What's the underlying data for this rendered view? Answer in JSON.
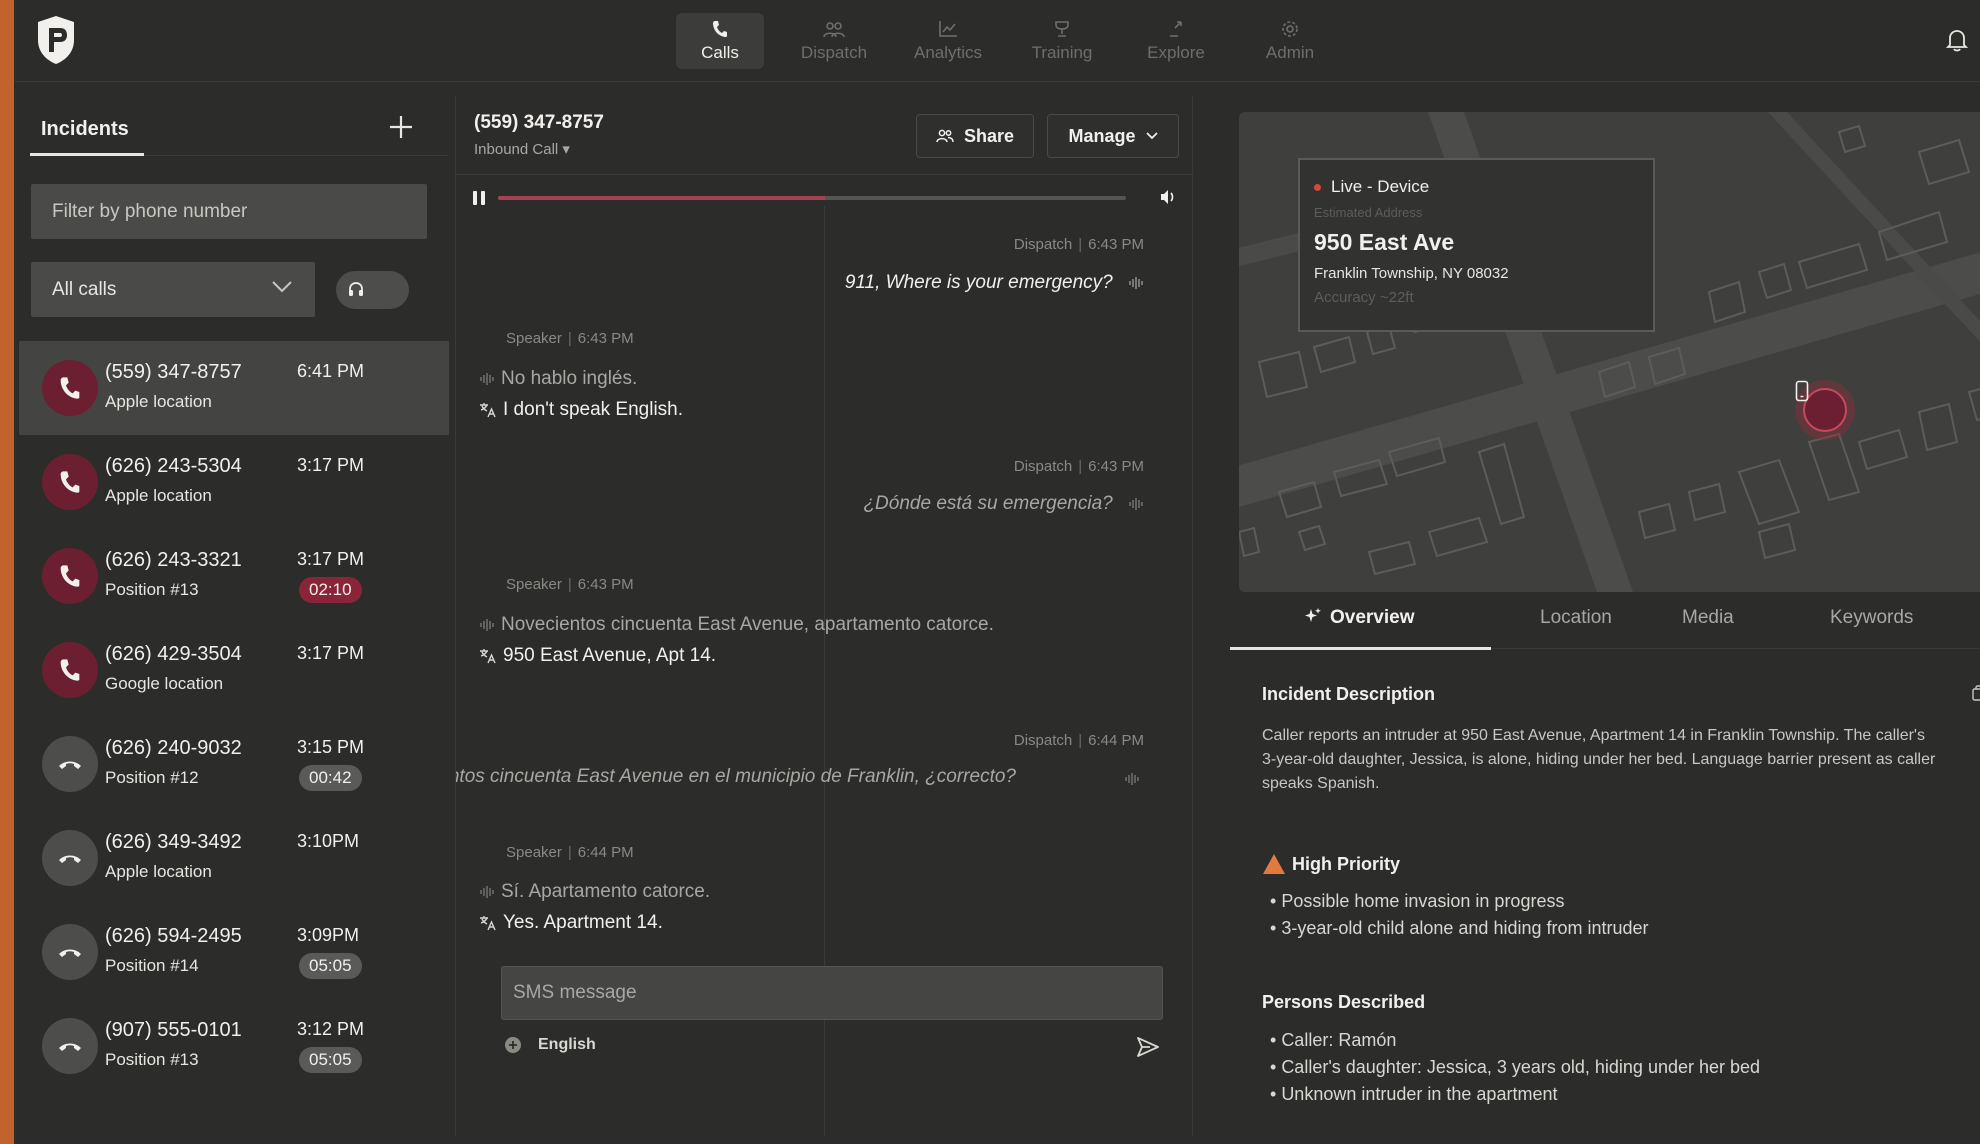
{
  "nav": {
    "items": [
      {
        "label": "Calls",
        "icon": "phone-icon",
        "active": true
      },
      {
        "label": "Dispatch",
        "icon": "dispatch-icon",
        "active": false
      },
      {
        "label": "Analytics",
        "icon": "analytics-icon",
        "active": false
      },
      {
        "label": "Training",
        "icon": "training-icon",
        "active": false
      },
      {
        "label": "Explore",
        "icon": "explore-icon",
        "active": false
      },
      {
        "label": "Admin",
        "icon": "gear-icon",
        "active": false
      }
    ]
  },
  "incidents": {
    "tab_label": "Incidents",
    "filter_placeholder": "Filter by phone number",
    "select_value": "All calls",
    "calls": [
      {
        "number": "(559) 347-8757",
        "sub": "Apple location",
        "time": "6:41 PM",
        "badge": "",
        "status": "active"
      },
      {
        "number": "(626) 243-5304",
        "sub": "Apple location",
        "time": "3:17 PM",
        "badge": "",
        "status": "active"
      },
      {
        "number": "(626) 243-3321",
        "sub": "Position #13",
        "time": "3:17 PM",
        "badge": "02:10",
        "status": "active"
      },
      {
        "number": "(626) 429-3504",
        "sub": "Google location",
        "time": "3:17 PM",
        "badge": "",
        "status": "active"
      },
      {
        "number": "(626) 240-9032",
        "sub": "Position #12",
        "time": "3:15 PM",
        "badge": "00:42",
        "status": "ended"
      },
      {
        "number": "(626) 349-3492",
        "sub": "Apple location",
        "time": "3:10PM",
        "badge": "",
        "status": "ended"
      },
      {
        "number": "(626) 594-2495",
        "sub": "Position #14",
        "time": "3:09PM",
        "badge": "05:05",
        "status": "ended"
      },
      {
        "number": "(907) 555-0101",
        "sub": "Position #13",
        "time": "3:12 PM",
        "badge": "05:05",
        "status": "ended"
      }
    ]
  },
  "transcript": {
    "phone": "(559) 347-8757",
    "call_type": "Inbound Call ▾",
    "share_label": "Share",
    "manage_label": "Manage",
    "progress": 0.52,
    "messages": [
      {
        "role": "Dispatch",
        "time": "6:43 PM",
        "text": "911, Where is your emergency?"
      },
      {
        "role": "Speaker",
        "time": "6:43 PM",
        "original": "No hablo inglés.",
        "translated": "I don't speak English."
      },
      {
        "role": "Dispatch",
        "time": "6:43 PM",
        "text": "¿Dónde está su emergencia?"
      },
      {
        "role": "Speaker",
        "time": "6:43 PM",
        "original": "Novecientos cincuenta East Avenue, apartamento catorce.",
        "translated": "950 East Avenue, Apt 14."
      },
      {
        "role": "Dispatch",
        "time": "6:44 PM",
        "text": "Novecientos cincuenta East Avenue en el municipio de Franklin, ¿correcto?"
      },
      {
        "role": "Speaker",
        "time": "6:44 PM",
        "original": "Sí. Apartamento catorce.",
        "translated": "Yes. Apartment 14."
      }
    ],
    "sms_placeholder": "SMS message",
    "language": "English"
  },
  "location": {
    "live_label": "Live - Device",
    "estimated_label": "Estimated Address",
    "address": "950 East Ave",
    "city": "Franklin Township, NY 08032",
    "accuracy": "Accuracy ~22ft"
  },
  "detail_tabs": [
    "Overview",
    "Location",
    "Media",
    "Keywords"
  ],
  "overview": {
    "description_title": "Incident Description",
    "description": "Caller reports an intruder at 950 East Avenue, Apartment 14 in Franklin Township. The caller's 3-year-old daughter, Jessica, is alone, hiding under her bed. Language barrier present as caller speaks Spanish.",
    "priority_label": "High Priority",
    "priority_items": [
      "Possible home invasion in progress",
      "3-year-old child alone and hiding from intruder"
    ],
    "persons_title": "Persons Described",
    "persons": [
      "Caller: Ramón",
      "Caller's daughter: Jessica, 3 years old, hiding under her bed",
      "Unknown intruder in the apartment"
    ]
  },
  "colors": {
    "accent_red": "#6b1f30",
    "badge_red": "#8a2438",
    "priority_orange": "#e07a3f",
    "edge_orange": "#c4622d"
  }
}
